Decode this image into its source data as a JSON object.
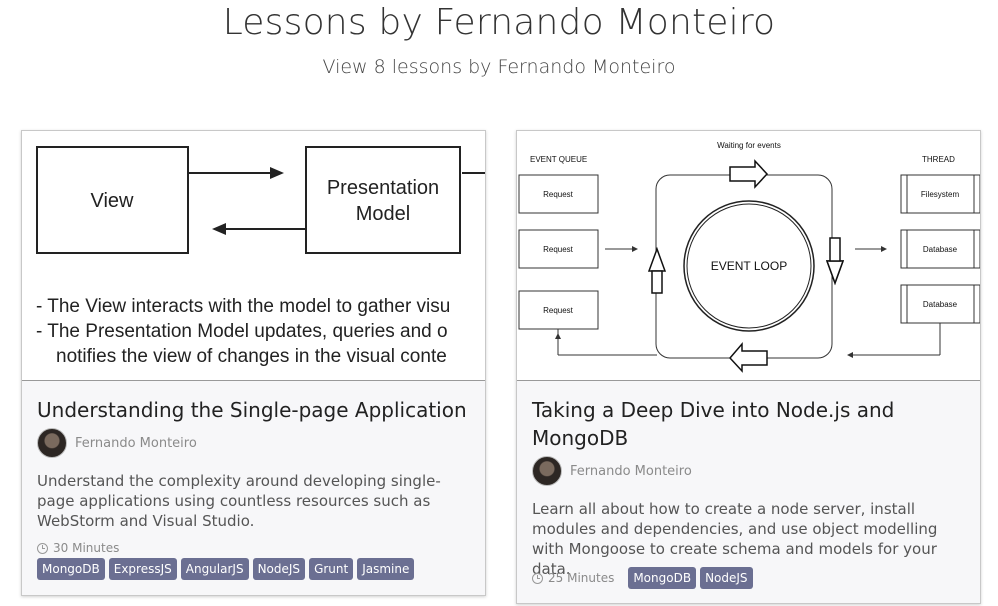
{
  "header": {
    "title": "Lessons by Fernando Monteiro",
    "subtitle": "View 8 lessons by Fernando Monteiro"
  },
  "lessons": [
    {
      "thumbnail": {
        "icon": "mvp-diagram-thumbnail",
        "view_label": "View",
        "presentation_label_line1": "Presentation",
        "presentation_label_line2": "Model",
        "bullet1": "- The View interacts with the model to gather visu",
        "bullet2": "- The Presentation Model updates, queries and o",
        "bullet3": "notifies the view of changes in the visual conte"
      },
      "title": "Understanding the Single-page Application",
      "author": "Fernando Monteiro",
      "description": "Understand the complexity around developing single-page applications using countless resources such as WebStorm and Visual Studio.",
      "duration": "30 Minutes",
      "tags": [
        "MongoDB",
        "ExpressJS",
        "AngularJS",
        "NodeJS",
        "Grunt",
        "Jasmine"
      ]
    },
    {
      "thumbnail": {
        "icon": "event-loop-diagram-thumbnail",
        "waiting": "Waiting for events",
        "event_queue": "EVENT QUEUE",
        "thread": "THREAD",
        "request": "Request",
        "event_loop": "EVENT LOOP",
        "filesystem": "Filesystem",
        "database": "Database"
      },
      "title": "Taking a Deep Dive into Node.js and MongoDB",
      "author": "Fernando Monteiro",
      "description": "Learn all about how to create a node server, install modules and dependencies, and use object modelling with Mongoose to create schema and models for your data.",
      "duration": "25 Minutes",
      "tags": [
        "MongoDB",
        "NodeJS"
      ]
    }
  ],
  "colors": {
    "tag_background": "#6b6f92",
    "card_background": "#f7f7f9"
  }
}
